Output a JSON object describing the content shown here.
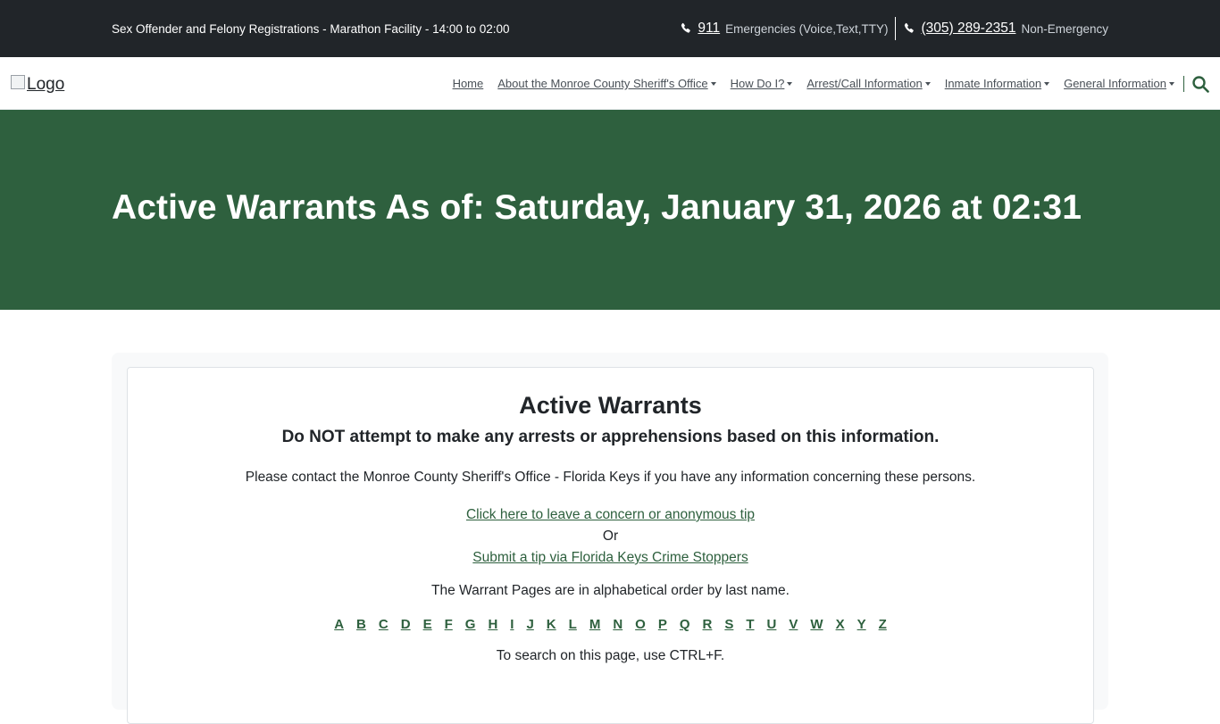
{
  "topbar": {
    "announcement": "Sex Offender and Felony Registrations - Marathon Facility - 14:00 to 02:00",
    "phones": [
      {
        "icon": "phone-icon",
        "number": "911",
        "label": "Emergencies (Voice,Text,TTY)"
      },
      {
        "icon": "phone-icon",
        "number": "(305) 289-2351",
        "label": "Non-Emergency"
      }
    ]
  },
  "navbar": {
    "logo_alt": "Logo",
    "items": [
      {
        "label": "Home",
        "dropdown": false
      },
      {
        "label": "About the Monroe County Sheriff's Office",
        "dropdown": true
      },
      {
        "label": "How Do I?",
        "dropdown": true
      },
      {
        "label": "Arrest/Call Information",
        "dropdown": true
      },
      {
        "label": "Inmate Information",
        "dropdown": true
      },
      {
        "label": "General Information",
        "dropdown": true
      }
    ],
    "search_icon": "search-icon"
  },
  "hero": {
    "title": "Active Warrants As of: Saturday, January 31, 2026 at 02:31"
  },
  "content": {
    "heading": "Active Warrants",
    "warning": "Do NOT attempt to make any arrests or apprehensions based on this information.",
    "contact": "Please contact the Monroe County Sheriff's Office - Florida Keys if you have any information concerning these persons.",
    "tip_link": "Click here to leave a concern or anonymous tip",
    "or": "Or",
    "crimestoppers_link": "Submit a tip via Florida Keys Crime Stoppers",
    "order_note": "The Warrant Pages are in alphabetical order by last name.",
    "letters": [
      "A",
      "B",
      "C",
      "D",
      "E",
      "F",
      "G",
      "H",
      "I",
      "J",
      "K",
      "L",
      "M",
      "N",
      "O",
      "P",
      "Q",
      "R",
      "S",
      "T",
      "U",
      "V",
      "W",
      "X",
      "Y",
      "Z"
    ],
    "search_note": "To search on this page, use CTRL+F."
  },
  "colors": {
    "brand_green": "#2e603e",
    "topbar_dark": "#212529"
  }
}
